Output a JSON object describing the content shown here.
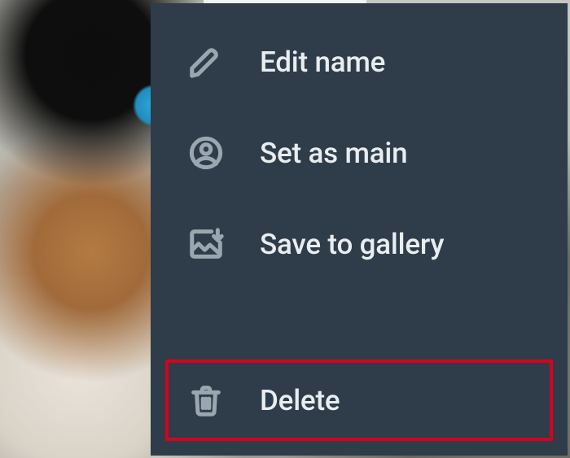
{
  "menu": {
    "items": [
      {
        "label": "Edit name"
      },
      {
        "label": "Set as main"
      },
      {
        "label": "Save to gallery"
      },
      {
        "label": "Delete"
      }
    ]
  },
  "highlight": {
    "color": "#d9001b"
  }
}
